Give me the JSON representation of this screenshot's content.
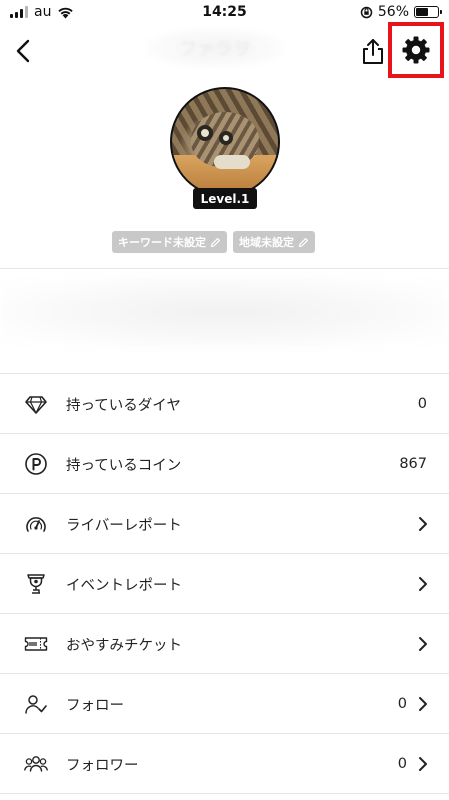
{
  "status_bar": {
    "carrier": "au",
    "time": "14:25",
    "battery_percent": "56%",
    "battery_level": 0.56
  },
  "nav": {
    "title": "ファラヲ",
    "icons": {
      "back": "chevron-left-icon",
      "share": "share-icon",
      "settings": "gear-icon"
    },
    "highlight_color": "#e8141b"
  },
  "profile": {
    "level_label": "Level.1",
    "tags": [
      {
        "label": "キーワード未設定",
        "icon": "pencil-icon"
      },
      {
        "label": "地域未設定",
        "icon": "pencil-icon"
      }
    ]
  },
  "menu": {
    "items": [
      {
        "key": "diamonds",
        "icon": "diamond-icon",
        "label": "持っているダイヤ",
        "value": "0",
        "chevron": false
      },
      {
        "key": "coins",
        "icon": "coin-icon",
        "label": "持っているコイン",
        "value": "867",
        "chevron": false
      },
      {
        "key": "liver-report",
        "icon": "gauge-icon",
        "label": "ライバーレポート",
        "value": "",
        "chevron": true
      },
      {
        "key": "event-report",
        "icon": "trophy-icon",
        "label": "イベントレポート",
        "value": "",
        "chevron": true
      },
      {
        "key": "rest-ticket",
        "icon": "ticket-icon",
        "label": "おやすみチケット",
        "value": "",
        "chevron": true
      },
      {
        "key": "follow",
        "icon": "follow-icon",
        "label": "フォロー",
        "value": "0",
        "chevron": true
      },
      {
        "key": "followers",
        "icon": "followers-icon",
        "label": "フォロワー",
        "value": "0",
        "chevron": true
      }
    ]
  }
}
